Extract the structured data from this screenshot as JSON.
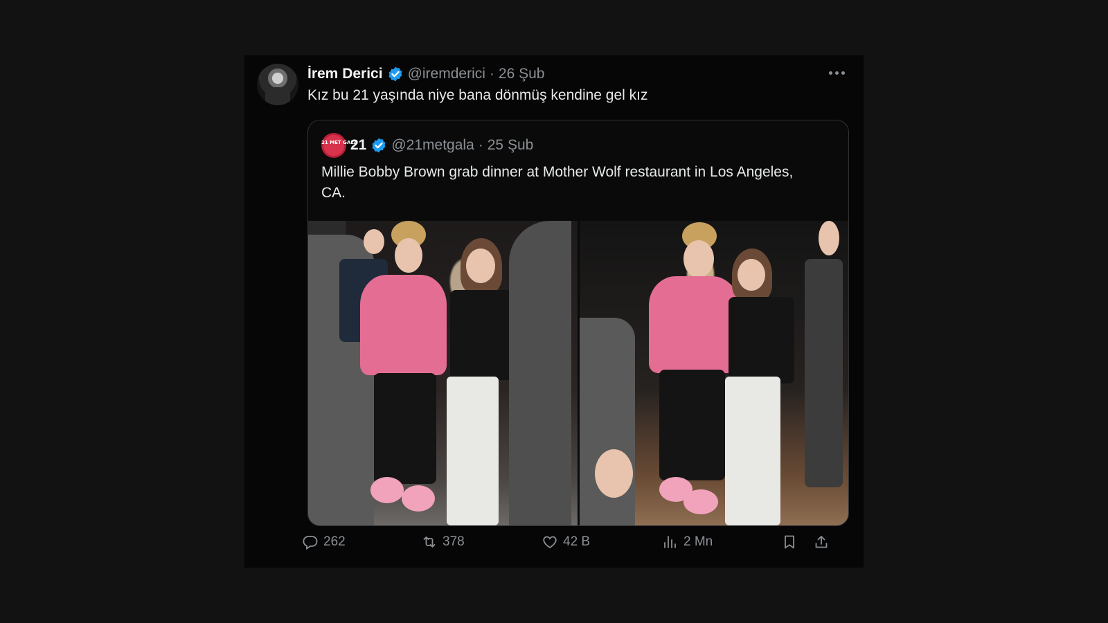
{
  "tweet": {
    "author_name": "İrem Derici",
    "handle": "@iremderici",
    "separator": "·",
    "date": "26 Şub",
    "text": "Kız bu 21 yaşında niye bana dönmüş kendine gel kız"
  },
  "quoted": {
    "avatar_text": "21 MET GALA",
    "author_name": "21",
    "handle": "@21metgala",
    "separator": "·",
    "date": "25 Şub",
    "text": "Millie Bobby Brown grab dinner at Mother Wolf restaurant in Los Angeles, CA."
  },
  "actions": {
    "replies": "262",
    "reposts": "378",
    "likes": "42 B",
    "views": "2 Mn"
  },
  "colors": {
    "page_bg": "#121212",
    "card_bg": "#060606",
    "verified": "#1d9bf0",
    "muted_text": "#8b9095"
  },
  "icons": [
    "verified-badge-icon",
    "more-options-icon",
    "reply-icon",
    "repost-icon",
    "like-icon",
    "views-icon",
    "bookmark-icon",
    "share-icon"
  ]
}
